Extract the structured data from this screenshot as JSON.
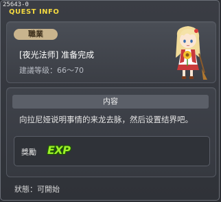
{
  "window": {
    "id": "25643-0",
    "title": "QUEST INFO"
  },
  "quest": {
    "job_badge": "職業",
    "name": "[夜光法师] 准备完成",
    "level_requirement": "建議等级：66～70",
    "npc_portrait": "npc-blonde-girl-icon"
  },
  "content": {
    "header": "内容",
    "description": "向拉尼娅说明事情的来龙去脉，然后设置结界吧。"
  },
  "reward": {
    "label": "獎勵",
    "exp_text": "EXP"
  },
  "status": {
    "text": "狀態：可開始"
  },
  "colors": {
    "title_yellow": "#f4d940",
    "badge_bg": "#c9b48d",
    "exp_green": "#9ef02a"
  }
}
